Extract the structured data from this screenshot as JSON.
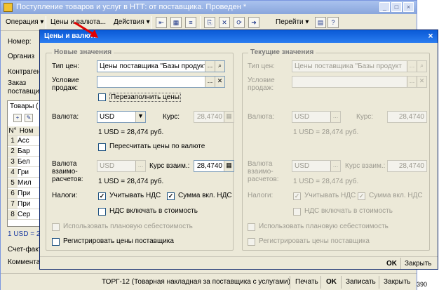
{
  "background_window": {
    "title": "Поступление товаров и услуг в НТТ: от поставщика. Проведен *",
    "title_buttons": [
      "_",
      "□",
      "×"
    ],
    "toolbar": {
      "operation": "Операция ▾",
      "prices": "Цены и валюта...",
      "actions": "Действия ▾",
      "goto": "Перейти ▾",
      "help": "?"
    },
    "labels": {
      "number": "Номер:",
      "organization": "Организ",
      "counterparty": "Контраген",
      "order": "Заказ",
      "order2": "поставщи",
      "tab_goods": "Товары (",
      "total": "1 USD = 2",
      "invoice": "Счет-факт",
      "comment": "Коммента"
    },
    "table_header": [
      "N°",
      "Ном"
    ],
    "table_rows": [
      {
        "n": "1",
        "name": "Асс"
      },
      {
        "n": "2",
        "name": "Бар"
      },
      {
        "n": "3",
        "name": "Бел"
      },
      {
        "n": "4",
        "name": "Гри"
      },
      {
        "n": "5",
        "name": "Мил"
      },
      {
        "n": "6",
        "name": "При"
      },
      {
        "n": "7",
        "name": "При"
      },
      {
        "n": "8",
        "name": "Сер"
      }
    ],
    "bottom_bar": {
      "torg": "ТОРГ-12 (Товарная накладная за поставщика с услугами)",
      "print": "Печать",
      "ok": "OK",
      "save": "Записать",
      "close": "Закрыть"
    },
    "corner_text": "390"
  },
  "dialog": {
    "title": "Цены и валюта",
    "close": "×",
    "new_values": {
      "group_title": "Новые значения",
      "price_type_label": "Тип цен:",
      "price_type_value": "Цены поставщика \"Базы продукт",
      "sale_terms_label": "Условие продаж:",
      "sale_terms_value": "",
      "refill_prices": "Перезаполнить цены",
      "currency_label": "Валюта:",
      "currency_value": "USD",
      "rate_label": "Курс:",
      "rate_value": "28,4740",
      "rate_text": "1 USD = 28,474 руб.",
      "recalc_label": "Пересчитать цены по валюте",
      "settlement_currency_label": "Валюта взаимо-расчетов:",
      "settlement_currency_value": "USD",
      "settlement_rate_label": "Курс взаим.:",
      "settlement_rate_value": "28,4740",
      "settlement_rate_text": "1 USD = 28,474 руб.",
      "taxes_label": "Налоги:",
      "consider_vat": "Учитывать НДС",
      "sum_incl_vat": "Сумма вкл. НДС",
      "vat_in_cost": "НДС включать в стоимость",
      "use_planned_cost": "Использовать плановую себестоимость",
      "register_prices": "Регистрировать цены поставщика"
    },
    "current_values": {
      "group_title": "Текущие значения",
      "price_type_label": "Тип цен:",
      "price_type_value": "Цены поставщика \"Базы продукт",
      "sale_terms_label": "Условие продаж:",
      "sale_terms_value": "",
      "currency_label": "Валюта:",
      "currency_value": "USD",
      "rate_label": "Курс:",
      "rate_value": "28,4740",
      "rate_text": "1 USD = 28,474 руб.",
      "settlement_currency_label": "Валюта взаимо-расчетов:",
      "settlement_currency_value": "USD",
      "settlement_rate_label": "Курс взаим.:",
      "settlement_rate_value": "28,4740",
      "settlement_rate_text": "1 USD = 28,474 руб.",
      "taxes_label": "Налоги:",
      "consider_vat": "Учитывать НДС",
      "sum_incl_vat": "Сумма вкл. НДС",
      "vat_in_cost": "НДС включать в стоимость",
      "use_planned_cost": "Использовать плановую себестоимость",
      "register_prices": "Регистрировать цены поставщика"
    },
    "footer": {
      "ok": "OK",
      "close": "Закрыть"
    }
  },
  "colors": {
    "dialog_title_bar": "#0a5ad6",
    "back_title_bar": "#a9c2ee",
    "arrow": "#e00000"
  }
}
